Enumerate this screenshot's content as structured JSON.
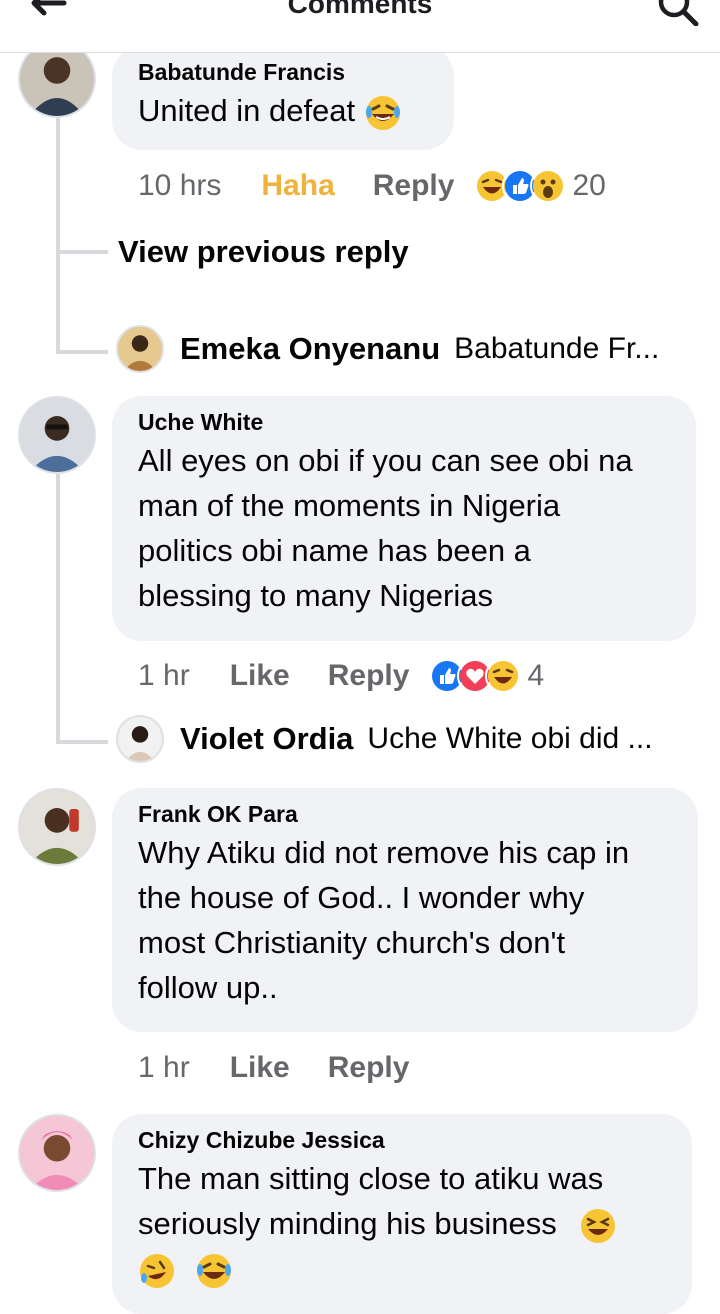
{
  "header": {
    "title": "Comments"
  },
  "comments": [
    {
      "author": "Babatunde Francis",
      "text": "United in defeat",
      "time": "10 hrs",
      "action1": "Haha",
      "action2": "Reply",
      "reaction_count": "20",
      "view_previous": "View previous reply",
      "reply": {
        "author": "Emeka Onyenanu",
        "snippet": "Babatunde Fr..."
      }
    },
    {
      "author": "Uche White",
      "lines": [
        "All eyes on obi if you can see obi na",
        "man of the moments in Nigeria",
        "politics obi name has been a",
        "blessing to many Nigerias"
      ],
      "time": "1 hr",
      "action1": "Like",
      "action2": "Reply",
      "reaction_count": "4",
      "reply": {
        "author": "Violet Ordia",
        "snippet": "Uche White obi did ..."
      }
    },
    {
      "author": "Frank OK Para",
      "lines": [
        "Why Atiku did not remove his cap in",
        "the house of God.. I wonder why",
        "most Christianity church's don't",
        "follow up.."
      ],
      "time": "1 hr",
      "action1": "Like",
      "action2": "Reply"
    },
    {
      "author": "Chizy Chizube Jessica",
      "lines": [
        "The man sitting close to atiku was",
        "seriously minding his business"
      ]
    }
  ],
  "colors": {
    "haha_active": "#f0b23a",
    "like_blue": "#1877f2",
    "love_red": "#f33e58",
    "meta_gray": "#65676b"
  }
}
